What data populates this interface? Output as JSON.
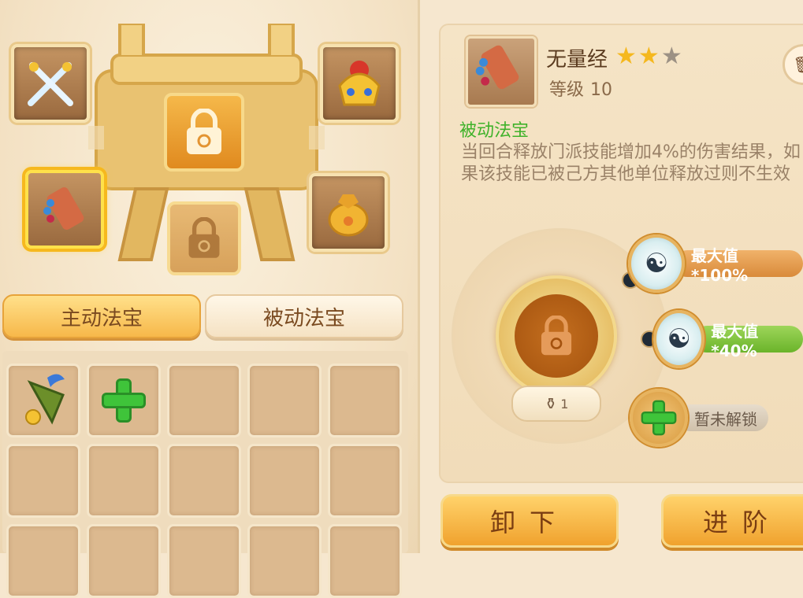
{
  "left": {
    "tabs": [
      {
        "label": "主动法宝",
        "active": true
      },
      {
        "label": "被动法宝",
        "active": false
      }
    ],
    "slots": [
      {
        "name": "crossed-swords",
        "icon": "crossed-swords-icon"
      },
      {
        "name": "armor-helmet",
        "icon": "armor-helmet-icon"
      },
      {
        "name": "scroll",
        "icon": "scroll-icon",
        "selected": true
      },
      {
        "name": "treasure-pouch",
        "icon": "treasure-pouch-icon"
      }
    ],
    "inventory": [
      {
        "icon": "bell-icon"
      },
      {
        "icon": "plus-icon"
      }
    ]
  },
  "detail": {
    "name": "无量经",
    "stars_filled": 2,
    "stars_total": 3,
    "level_label": "等级",
    "level_value": "10",
    "type_label": "被动法宝",
    "description": "当回合释放门派技能增加4%的伤害结果，如果该技能已被己方其他单位释放过则不生效",
    "medallion_level": "1",
    "attributes": [
      {
        "icon": "yin-yang-icon",
        "label": "最大值*100%",
        "style": "orange"
      },
      {
        "icon": "yin-yang-icon",
        "label": "最大值*40%",
        "style": "green"
      },
      {
        "icon": "plus-icon",
        "label": "暂未解锁",
        "style": "grey"
      }
    ]
  },
  "buttons": {
    "unequip": "卸下",
    "advance": "进阶"
  },
  "colors": {
    "accent": "#f0a22e",
    "passive_green": "#3fb22a",
    "text_brown": "#7a4a20"
  }
}
